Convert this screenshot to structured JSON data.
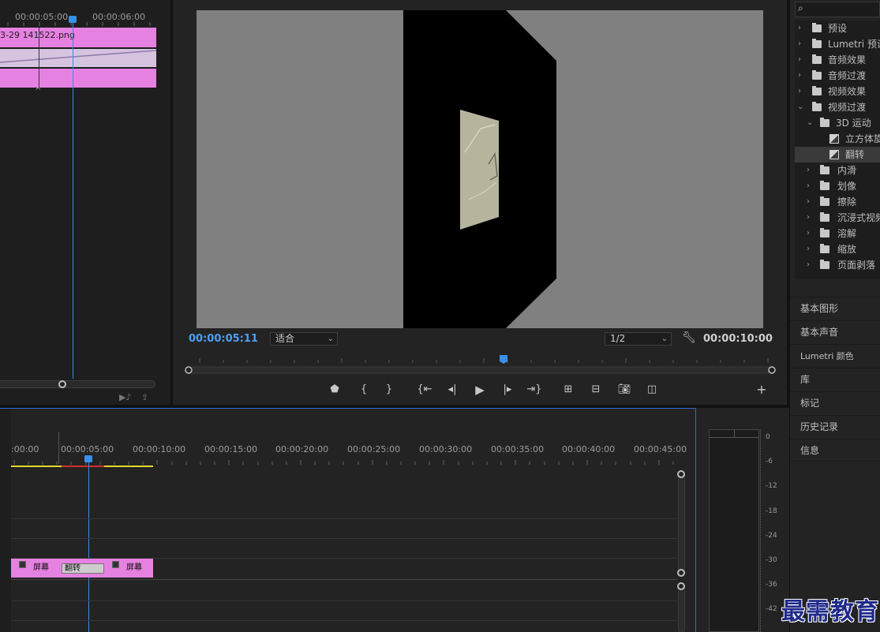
{
  "effect_controls": {
    "ruler_labels": [
      "00:00:05:00",
      "00:00:06:00"
    ],
    "clip_name": "3-29 141522.png"
  },
  "program_monitor": {
    "current_timecode": "00:00:05:11",
    "fit_select": "适合",
    "resolution_select": "1/2",
    "duration_timecode": "00:00:10:00",
    "controls": [
      "marker-icon",
      "in-point-icon",
      "out-point-icon",
      "go-to-in-icon",
      "step-back-icon",
      "play-icon",
      "step-forward-icon",
      "go-to-out-icon",
      "lift-icon",
      "extract-icon",
      "export-frame-icon",
      "compare-icon",
      "add-icon"
    ]
  },
  "effects_panel": {
    "items": [
      {
        "label": "预设",
        "level": 0,
        "type": "folder-star",
        "expanded": false
      },
      {
        "label": "Lumetri 预设",
        "level": 0,
        "type": "folder-star",
        "expanded": false
      },
      {
        "label": "音频效果",
        "level": 0,
        "type": "folder",
        "expanded": false
      },
      {
        "label": "音频过渡",
        "level": 0,
        "type": "folder",
        "expanded": false
      },
      {
        "label": "视频效果",
        "level": 0,
        "type": "folder",
        "expanded": false
      },
      {
        "label": "视频过渡",
        "level": 0,
        "type": "folder",
        "expanded": true
      },
      {
        "label": "3D 运动",
        "level": 1,
        "type": "folder",
        "expanded": true
      },
      {
        "label": "立方体旋转",
        "level": 2,
        "type": "effect"
      },
      {
        "label": "翻转",
        "level": 2,
        "type": "effect",
        "selected": true
      },
      {
        "label": "内滑",
        "level": 1,
        "type": "folder",
        "expanded": false
      },
      {
        "label": "划像",
        "level": 1,
        "type": "folder",
        "expanded": false
      },
      {
        "label": "擦除",
        "level": 1,
        "type": "folder",
        "expanded": false
      },
      {
        "label": "沉浸式视频",
        "level": 1,
        "type": "folder",
        "expanded": false
      },
      {
        "label": "溶解",
        "level": 1,
        "type": "folder",
        "expanded": false
      },
      {
        "label": "缩放",
        "level": 1,
        "type": "folder",
        "expanded": false
      },
      {
        "label": "页面剥落",
        "level": 1,
        "type": "folder",
        "expanded": false
      }
    ],
    "side_tabs": [
      "基本图形",
      "基本声音",
      "Lumetri 颜色",
      "库",
      "标记",
      "历史记录",
      "信息"
    ]
  },
  "timeline": {
    "ruler_labels": [
      ":00:00",
      "00:00:05:00",
      "00:00:10:00",
      "00:00:15:00",
      "00:00:20:00",
      "00:00:25:00",
      "00:00:30:00",
      "00:00:35:00",
      "00:00:40:00",
      "00:00:45:00"
    ],
    "clip_a": "屏幕",
    "transition": "翻转",
    "clip_b": "屏幕"
  },
  "audio_meter": {
    "db_labels": [
      "0",
      "-6",
      "-12",
      "-18",
      "-24",
      "-30",
      "-36",
      "-42"
    ]
  },
  "watermark": "最需教育",
  "colors": {
    "accent": "#2d8ceb",
    "clip_pink": "#e581e0",
    "timecode_blue": "#4e9ff5"
  }
}
